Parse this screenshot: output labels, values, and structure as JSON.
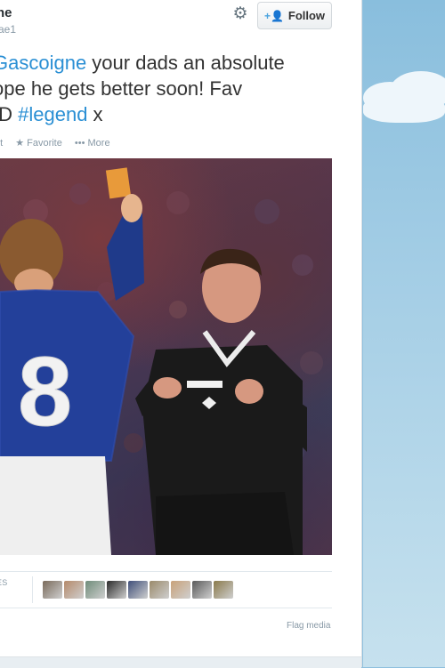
{
  "tweet": {
    "author_name": "ne",
    "author_handle": "ae1",
    "follow_label": "Follow",
    "text_parts": {
      "mention": "Gascoigne",
      "line1_rest": " your dads an absolute",
      "line2": "ope he gets better soon! Fav",
      "line3_prefix": " :D ",
      "hashtag": "#legend",
      "line3_suffix": " x"
    },
    "actions": {
      "retweet": "et",
      "favorite": "Favorite",
      "more": "More"
    },
    "stats_label": "ES",
    "flag_label": "Flag media"
  },
  "icons": {
    "gear": "gear-icon",
    "follow": "add-user-icon",
    "favorite": "star-icon",
    "more": "ellipsis-icon"
  },
  "avatars": [
    {
      "color": "#7a6a5a"
    },
    {
      "color": "#b58a6a"
    },
    {
      "color": "#6f8c7a"
    },
    {
      "color": "#2b2b2b"
    },
    {
      "color": "#3f4f7a"
    },
    {
      "color": "#9a8a6a"
    },
    {
      "color": "#c9a27a"
    },
    {
      "color": "#5a5a5a"
    },
    {
      "color": "#8a7a4a"
    }
  ],
  "colors": {
    "link": "#2a8fd4",
    "text": "#333333",
    "muted": "#8899a6"
  }
}
